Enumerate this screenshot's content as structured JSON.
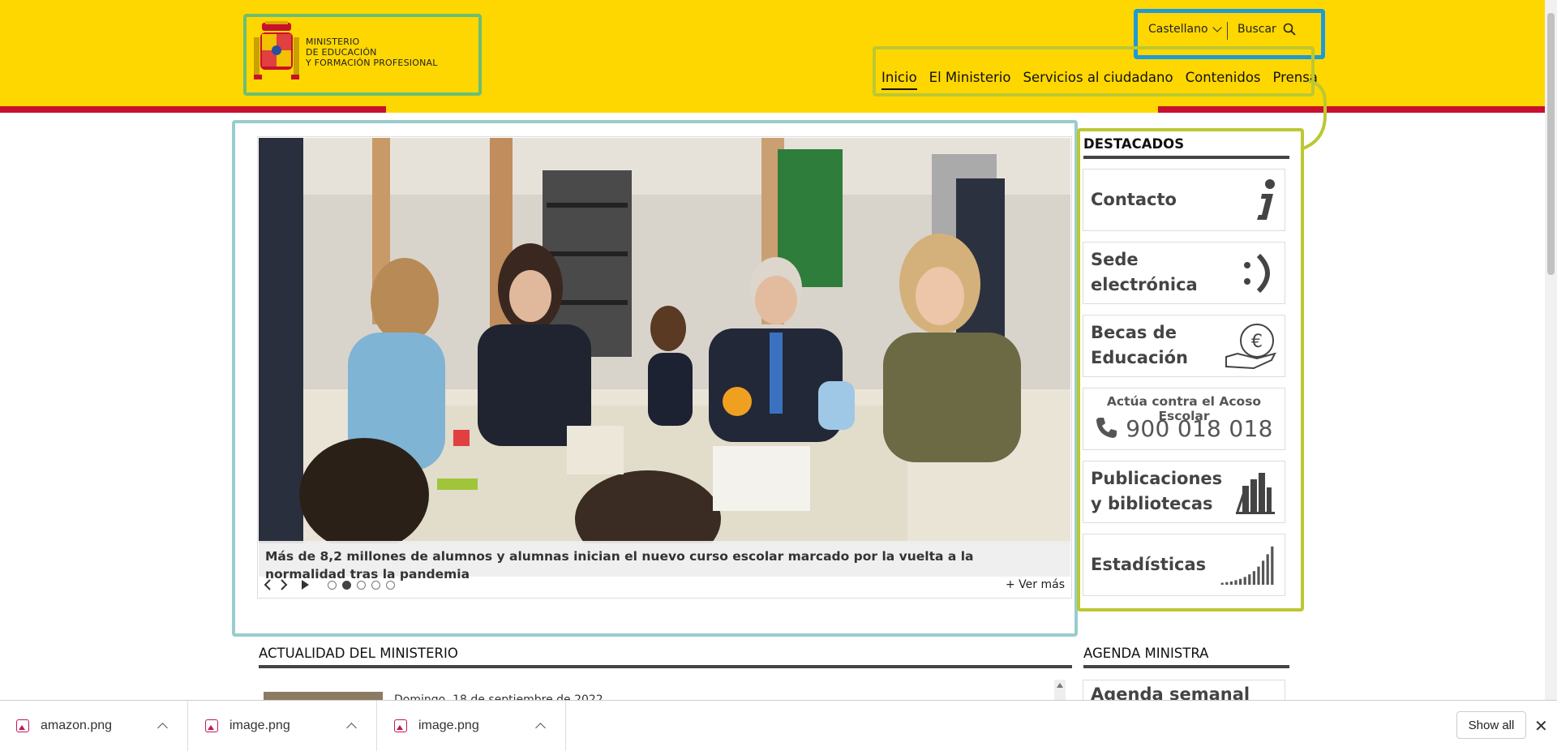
{
  "header": {
    "logo_lines": [
      "MINISTERIO",
      "DE EDUCACIÓN",
      "Y FORMACIÓN PROFESIONAL"
    ],
    "language": "Castellano",
    "search_label": "Buscar",
    "nav": [
      "Inicio",
      "El Ministerio",
      "Servicios al ciudadano",
      "Contenidos",
      "Prensa"
    ]
  },
  "carousel": {
    "caption": "Más de 8,2 millones de alumnos y alumnas inician el nuevo curso escolar marcado por la vuelta a la normalidad tras la pandemia",
    "slide_count": 5,
    "active_slide": 2,
    "more_label": "Ver más"
  },
  "destacados": {
    "title": "DESTACADOS",
    "items": [
      {
        "label": "Contacto",
        "icon": "info-icon"
      },
      {
        "label": "Sede electrónica",
        "icon": "smiley-icon"
      },
      {
        "label": "Becas de Educación",
        "icon": "euro-hand-icon"
      },
      {
        "label": "Publicaciones y bibliotecas",
        "icon": "books-icon"
      },
      {
        "label": "Estadísticas",
        "icon": "bar-chart-icon"
      }
    ],
    "acoso": {
      "title": "Actúa contra el Acoso Escolar",
      "phone": "900 018 018"
    }
  },
  "actualidad": {
    "title": "ACTUALIDAD DEL MINISTERIO",
    "first_date": "Domingo, 18 de septiembre de 2022"
  },
  "agenda": {
    "title": "AGENDA MINISTRA",
    "card_label": "Agenda semanal"
  },
  "downloads": {
    "items": [
      "amazon.png",
      "image.png",
      "image.png"
    ],
    "show_all": "Show all"
  },
  "colors": {
    "header_yellow": "#ffd700",
    "header_red": "#c8102e",
    "annotation_green": "#6bbf73",
    "annotation_blue": "#1e9ad6",
    "annotation_lime": "#bcc832",
    "annotation_teal": "#99cccc"
  }
}
